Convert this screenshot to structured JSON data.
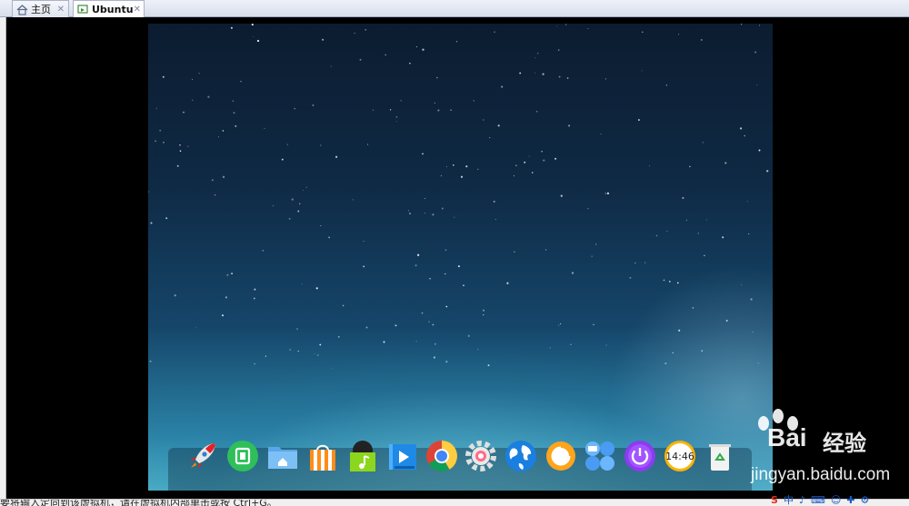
{
  "tabs": [
    {
      "label": "主页",
      "icon": "home-icon",
      "close": "✕"
    },
    {
      "label": "Ubuntu",
      "icon": "vm-icon",
      "close": "✕"
    }
  ],
  "desktop": {
    "dock_items": [
      {
        "name": "launcher",
        "icon": "rocket-icon"
      },
      {
        "name": "multitask",
        "icon": "multitask-view-icon"
      },
      {
        "name": "file-manager",
        "icon": "folder-icon"
      },
      {
        "name": "app-store",
        "icon": "store-bag-icon"
      },
      {
        "name": "music",
        "icon": "music-icon"
      },
      {
        "name": "video",
        "icon": "video-icon"
      },
      {
        "name": "chrome",
        "icon": "chrome-icon"
      },
      {
        "name": "settings",
        "icon": "gear-icon"
      },
      {
        "name": "browser",
        "icon": "globe-icon"
      },
      {
        "name": "messenger",
        "icon": "ring-icon"
      },
      {
        "name": "apps",
        "icon": "grid-apps-icon"
      },
      {
        "name": "shutdown",
        "icon": "power-icon"
      },
      {
        "name": "clock",
        "icon": "clock-icon"
      },
      {
        "name": "trash",
        "icon": "recycle-icon"
      }
    ],
    "clock_time": "14:46"
  },
  "watermark": {
    "brand_latin": "Bai",
    "brand_cn": "经验",
    "url": "jingyan.baidu.com"
  },
  "statusbar": {
    "text": "要将输入定向到该虚拟机，请在虚拟机内部单击或按 Ctrl+G。"
  },
  "tray": [
    "S",
    "中",
    "♪",
    "⌨",
    "☺",
    "✚",
    "⚙"
  ]
}
